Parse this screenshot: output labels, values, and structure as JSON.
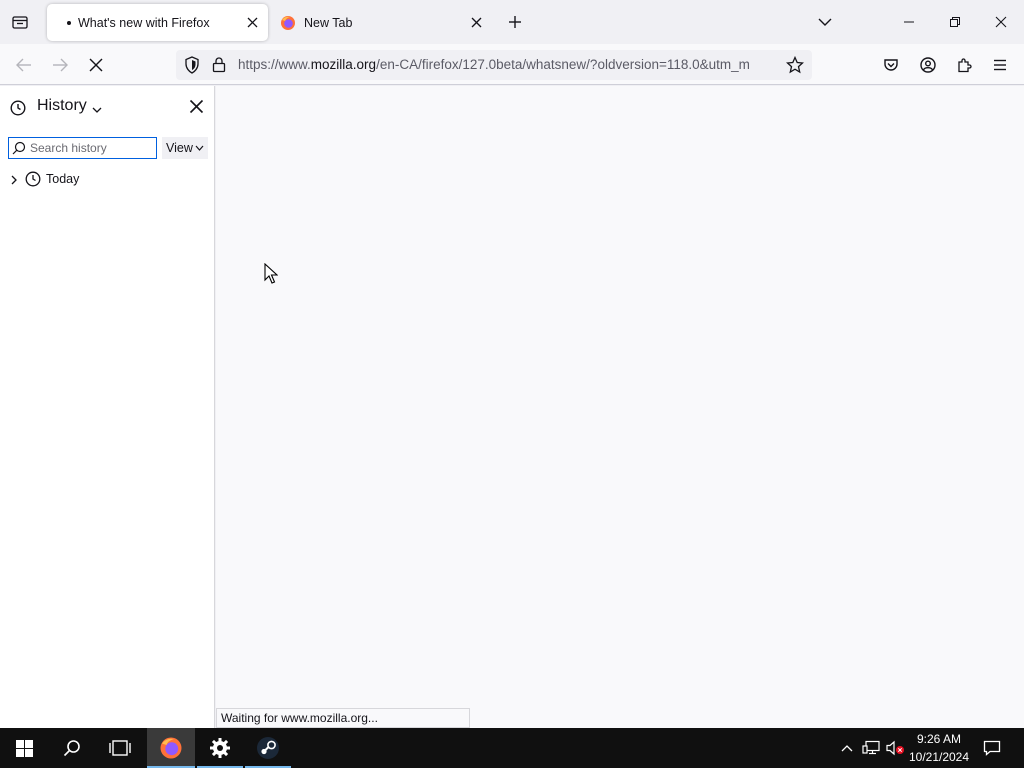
{
  "tabs": [
    {
      "title": "What's new with Firefox",
      "active": true,
      "loading": true
    },
    {
      "title": "New Tab",
      "active": false,
      "icon": "firefox-logo"
    }
  ],
  "address_bar": {
    "url_prefix": "https://www.",
    "url_domain": "mozilla.org",
    "url_rest": "/en-CA/firefox/127.0beta/whatsnew/?oldversion=118.0&utm_m"
  },
  "sidebar": {
    "title": "History",
    "search_placeholder": "Search history",
    "view_label": "View",
    "items": [
      {
        "label": "Today"
      }
    ]
  },
  "status": {
    "text": "Waiting for www.mozilla.org..."
  },
  "taskbar": {
    "time": "9:26 AM",
    "date": "10/21/2024"
  },
  "colors": {
    "accent": "#0060df",
    "taskbar": "#101010",
    "chrome": "#f0f0f4"
  }
}
